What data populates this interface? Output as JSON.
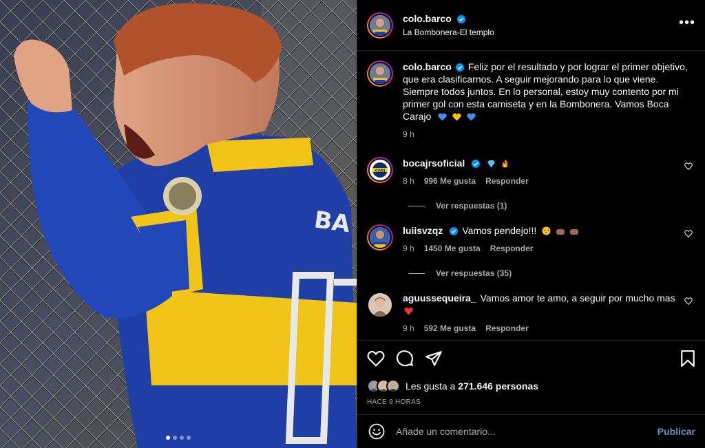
{
  "post": {
    "username": "colo.barco",
    "location": "La Bombonera-El templo",
    "more_icon": "more-horizontal-icon",
    "caption": "Feliz por el resultado y por lograr el primer objetivo, que era clasificarnos. A seguir mejorando para lo que viene. Siempre todos juntos. En lo personal, estoy muy contento por mi primer gol con esta camiseta y en la Bombonera. Vamos Boca Carajo",
    "caption_emojis": [
      "blue-heart",
      "yellow-heart",
      "blue-heart"
    ],
    "caption_time": "9 h",
    "carousel_count": 4,
    "carousel_active": 0
  },
  "comments": [
    {
      "username": "bocajrsoficial",
      "text": "",
      "emojis": [
        "gem",
        "fire"
      ],
      "time": "8 h",
      "likes": "996 Me gusta",
      "reply": "Responder",
      "view_replies": "Ver respuestas (1)"
    },
    {
      "username": "luiisvzqz",
      "text": "Vamos pendejo!!!",
      "emojis": [
        "star-struck",
        "raised-fist",
        "raised-fist"
      ],
      "time": "9 h",
      "likes": "1450 Me gusta",
      "reply": "Responder",
      "view_replies": "Ver respuestas (35)"
    },
    {
      "username": "aguussequeira_",
      "text": "Vamos amor te amo, a seguir por mucho mas",
      "emojis": [
        "red-heart"
      ],
      "time": "9 h",
      "likes": "592 Me gusta",
      "reply": "Responder"
    }
  ],
  "actions": {
    "like_icon": "heart-icon",
    "comment_icon": "comment-icon",
    "share_icon": "send-icon",
    "save_icon": "bookmark-icon",
    "likes_prefix": "Les gusta a",
    "likes_count": "271.646 personas",
    "timestamp": "HACE 9 HORAS"
  },
  "composer": {
    "placeholder": "Añade un comentario...",
    "publish_label": "Publicar",
    "emoji_icon": "smiley-icon"
  },
  "colors": {
    "background": "#000000",
    "verified": "#0095f6",
    "publish": "#6d8cb8",
    "boca_blue": "#1f3fa6",
    "boca_yellow": "#f0c419"
  }
}
